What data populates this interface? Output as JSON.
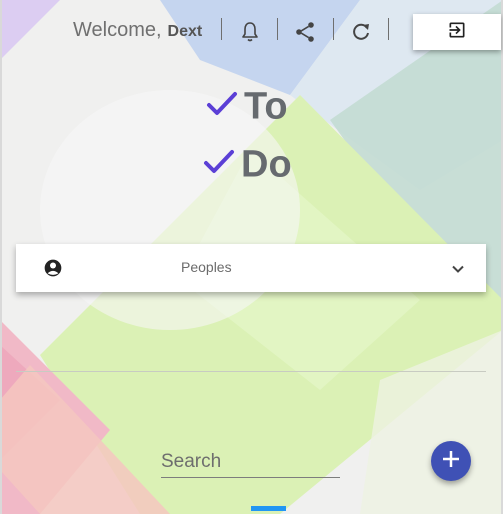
{
  "header": {
    "welcome_text": "Welcome,",
    "user_name": "Dext",
    "icons": [
      "bell-icon",
      "share-icon",
      "refresh-icon",
      "logout-icon"
    ]
  },
  "title": {
    "line1": "To",
    "line2": "Do",
    "check_color": "#5b3fd6"
  },
  "people_dropdown": {
    "label": "Peoples",
    "icon": "person-circle-icon",
    "chevron": "chevron-down-icon"
  },
  "search": {
    "placeholder": "Search",
    "value": ""
  },
  "fab": {
    "icon": "plus-icon",
    "color": "#3f51b5"
  },
  "colors": {
    "accent": "#3f51b5",
    "tab_indicator": "#2196f3"
  }
}
